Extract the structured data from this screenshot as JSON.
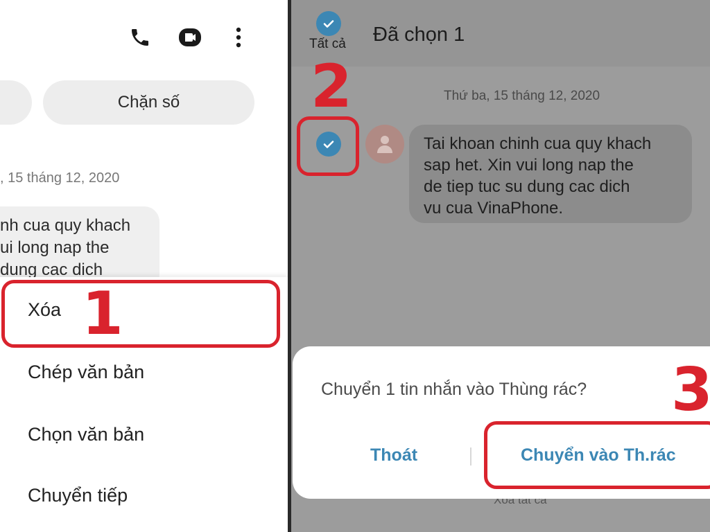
{
  "left_panel": {
    "top_icons": [
      "phone-icon",
      "video-call-icon",
      "more-vertical-icon"
    ],
    "chips": {
      "block_label": "Chặn số"
    },
    "message_date": ", 15 tháng 12, 2020",
    "bubble_lines": [
      "nh cua quy khach",
      "ui long nap the",
      " dung cac dich"
    ],
    "context_menu": {
      "delete": "Xóa",
      "copy_text": "Chép văn bản",
      "select_text": "Chọn văn bản",
      "forward": "Chuyển tiếp"
    },
    "step_label": "1"
  },
  "right_panel": {
    "header": {
      "select_all_label": "Tất cả",
      "title": "Đã chọn 1"
    },
    "step2_label": "2",
    "message_date": "Thứ ba, 15 tháng 12, 2020",
    "message_lines": [
      "Tai khoan chinh cua quy khach",
      "sap het. Xin vui long nap the",
      "de tiep tuc su dung cac dich",
      "vu cua VinaPhone."
    ],
    "under_dialog_text": "Xóa tất cả",
    "dialog": {
      "question": "Chuyển 1 tin nhắn vào Thùng rác?",
      "cancel_label": "Thoát",
      "confirm_label": "Chuyển vào Th.rác"
    },
    "step3_label": "3"
  },
  "colors": {
    "highlight_red": "#d9232d",
    "accent_blue": "#3c87b4",
    "dim_background": "#9c9c9c"
  }
}
